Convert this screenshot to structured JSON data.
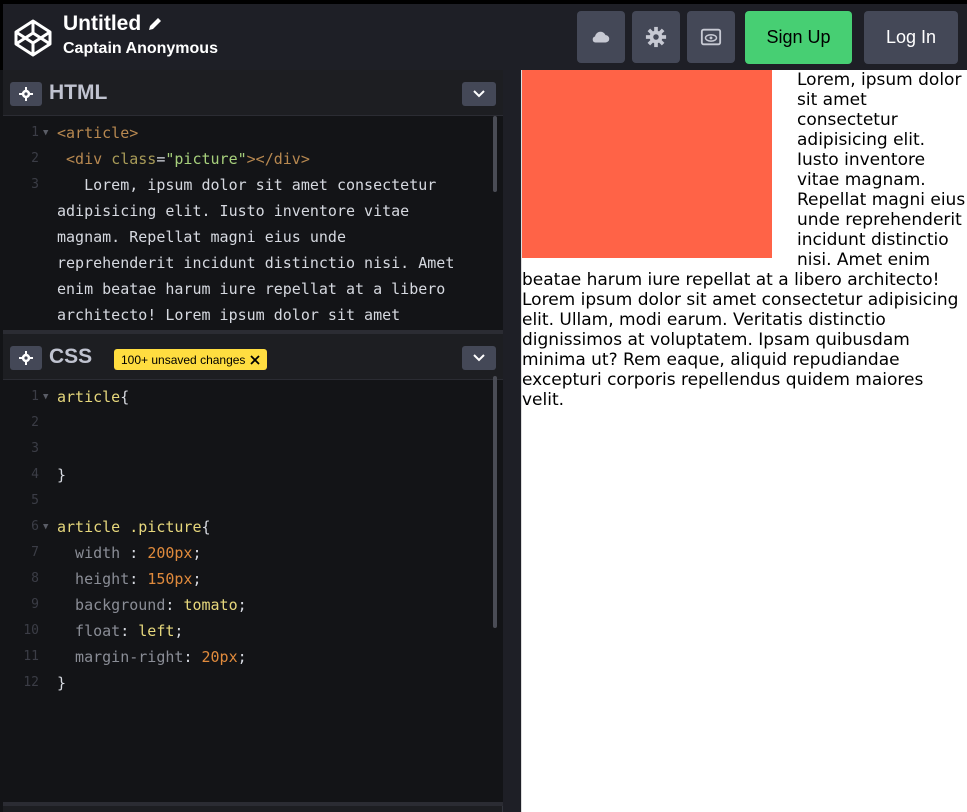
{
  "header": {
    "title": "Untitled",
    "author": "Captain Anonymous",
    "signup_label": "Sign Up",
    "login_label": "Log In",
    "icons": [
      "codepen-logo-icon",
      "pencil-icon",
      "cloud-icon",
      "settings-icon",
      "view-icon"
    ]
  },
  "html_panel": {
    "label": "HTML",
    "lines": [
      {
        "n": "1",
        "parts": [
          [
            "tag",
            "<article>"
          ]
        ]
      },
      {
        "n": "2",
        "parts": [
          [
            "tag",
            " <div "
          ],
          [
            "attr",
            "class"
          ],
          [
            "punc",
            "="
          ],
          [
            "str",
            "\"picture\""
          ],
          [
            "tag",
            "></div>"
          ]
        ]
      },
      {
        "n": "3",
        "parts": [
          [
            "txt",
            "   Lorem, ipsum dolor sit amet consectetur"
          ]
        ]
      },
      {
        "n": "",
        "parts": [
          [
            "txt",
            "adipisicing elit. Iusto inventore vitae"
          ]
        ]
      },
      {
        "n": "",
        "parts": [
          [
            "txt",
            "magnam. Repellat magni eius unde"
          ]
        ]
      },
      {
        "n": "",
        "parts": [
          [
            "txt",
            "reprehenderit incidunt distinctio nisi. Amet"
          ]
        ]
      },
      {
        "n": "",
        "parts": [
          [
            "txt",
            "enim beatae harum iure repellat at a libero"
          ]
        ]
      },
      {
        "n": "",
        "parts": [
          [
            "txt",
            "architecto! Lorem ipsum dolor sit amet"
          ]
        ]
      }
    ]
  },
  "css_panel": {
    "label": "CSS",
    "badge": "100+ unsaved changes",
    "lines": [
      {
        "n": "1",
        "parts": [
          [
            "sel",
            "article"
          ],
          [
            "punc",
            "{"
          ]
        ]
      },
      {
        "n": "2",
        "parts": []
      },
      {
        "n": "3",
        "parts": []
      },
      {
        "n": "4",
        "parts": [
          [
            "punc",
            "}"
          ]
        ]
      },
      {
        "n": "5",
        "parts": []
      },
      {
        "n": "6",
        "parts": [
          [
            "sel",
            "article .picture"
          ],
          [
            "punc",
            "{"
          ]
        ]
      },
      {
        "n": "7",
        "parts": [
          [
            "prop",
            "  width"
          ],
          [
            "punc",
            " : "
          ],
          [
            "num",
            "200px"
          ],
          [
            "punc",
            ";"
          ]
        ]
      },
      {
        "n": "8",
        "parts": [
          [
            "prop",
            "  height"
          ],
          [
            "punc",
            ": "
          ],
          [
            "num",
            "150px"
          ],
          [
            "punc",
            ";"
          ]
        ]
      },
      {
        "n": "9",
        "parts": [
          [
            "prop",
            "  background"
          ],
          [
            "punc",
            ": "
          ],
          [
            "kw",
            "tomato"
          ],
          [
            "punc",
            ";"
          ]
        ]
      },
      {
        "n": "10",
        "parts": [
          [
            "prop",
            "  float"
          ],
          [
            "punc",
            ": "
          ],
          [
            "kw",
            "left"
          ],
          [
            "punc",
            ";"
          ]
        ]
      },
      {
        "n": "11",
        "parts": [
          [
            "prop",
            "  margin-right"
          ],
          [
            "punc",
            ": "
          ],
          [
            "num",
            "20px"
          ],
          [
            "punc",
            ";"
          ]
        ]
      },
      {
        "n": "12",
        "parts": [
          [
            "punc",
            "}"
          ]
        ]
      }
    ]
  },
  "preview": {
    "box_color": "#ff6347",
    "text": "Lorem, ipsum dolor sit amet consectetur adipisicing elit. Iusto inventore vitae magnam. Repellat magni eius unde reprehenderit incidunt distinctio nisi. Amet enim beatae harum iure repellat at a libero architecto! Lorem ipsum dolor sit amet consectetur adipisicing elit. Ullam, modi earum. Veritatis distinctio dignissimos at voluptatem. Ipsam quibusdam minima ut? Rem eaque, aliquid repudiandae excepturi corporis repellendus quidem maiores velit."
  },
  "colors": {
    "accent_green": "#47cf73",
    "badge_yellow": "#ffdd40",
    "button_gray": "#444857"
  }
}
